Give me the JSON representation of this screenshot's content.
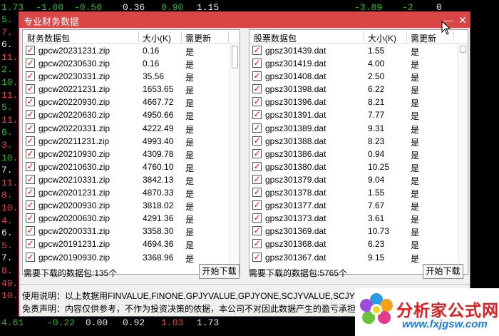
{
  "background": {
    "top_row": [
      "1.73",
      "-1.00",
      "-0.56",
      "0.36",
      "0.90",
      "1.15",
      "-3.89",
      "-2",
      "0"
    ],
    "bottom_row": [
      "4.61",
      "-0.22",
      "0.00",
      "0.92",
      "1.03",
      "1.73"
    ],
    "left_nums": [
      "5.",
      "7.",
      "6.",
      "11.",
      "2.",
      "10.",
      "11.",
      "5.",
      "11.",
      "6.",
      "3.",
      "10.",
      "7.",
      "11.",
      "8.",
      "10.",
      "4.",
      "6.",
      "5.",
      "7.",
      "8.",
      "49.",
      "10."
    ],
    "right_nums": [
      "",
      "",
      "",
      "",
      "",
      "",
      "",
      "",
      "",
      "",
      "",
      "",
      "",
      "",
      "",
      "",
      "",
      "",
      "",
      "",
      ""
    ]
  },
  "dialog": {
    "title": "专业财务数据",
    "minimize": "—",
    "close": "✕",
    "left": {
      "col_name": "财务数据包",
      "col_size": "大小(K)",
      "col_update": "需更新",
      "rows": [
        {
          "name": "gpcw20231231.zip",
          "size": "0.16",
          "update": "是"
        },
        {
          "name": "gpcw20230630.zip",
          "size": "0.16",
          "update": "是"
        },
        {
          "name": "gpcw20230331.zip",
          "size": "35.56",
          "update": "是"
        },
        {
          "name": "gpcw20221231.zip",
          "size": "1653.65",
          "update": "是"
        },
        {
          "name": "gpcw20220930.zip",
          "size": "4667.72",
          "update": "是"
        },
        {
          "name": "gpcw20220630.zip",
          "size": "4950.66",
          "update": "是"
        },
        {
          "name": "gpcw20220331.zip",
          "size": "4222.49",
          "update": "是"
        },
        {
          "name": "gpcw20211231.zip",
          "size": "4993.40",
          "update": "是"
        },
        {
          "name": "gpcw20210930.zip",
          "size": "4309.78",
          "update": "是"
        },
        {
          "name": "gpcw20210630.zip",
          "size": "4760.10",
          "update": "是"
        },
        {
          "name": "gpcw20210331.zip",
          "size": "3842.13",
          "update": "是"
        },
        {
          "name": "gpcw20201231.zip",
          "size": "4870.33",
          "update": "是"
        },
        {
          "name": "gpcw20200930.zip",
          "size": "3818.02",
          "update": "是"
        },
        {
          "name": "gpcw20200630.zip",
          "size": "4291.36",
          "update": "是"
        },
        {
          "name": "gpcw20200331.zip",
          "size": "3358.30",
          "update": "是"
        },
        {
          "name": "gpcw20191231.zip",
          "size": "4694.36",
          "update": "是"
        },
        {
          "name": "gpcw20190930.zip",
          "size": "3368.96",
          "update": "是"
        }
      ],
      "count_label": "需要下载的数据包:135个",
      "start_btn": "开始下载"
    },
    "right": {
      "col_name": "股票数据包",
      "col_size": "大小(K)",
      "col_update": "需更新",
      "rows": [
        {
          "name": "gpsz301439.dat",
          "size": "1.55",
          "update": "是"
        },
        {
          "name": "gpsz301419.dat",
          "size": "4.00",
          "update": "是"
        },
        {
          "name": "gpsz301408.dat",
          "size": "2.50",
          "update": "是"
        },
        {
          "name": "gpsz301398.dat",
          "size": "6.22",
          "update": "是"
        },
        {
          "name": "gpsz301396.dat",
          "size": "8.21",
          "update": "是"
        },
        {
          "name": "gpsz301391.dat",
          "size": "7.77",
          "update": "是"
        },
        {
          "name": "gpsz301389.dat",
          "size": "9.31",
          "update": "是"
        },
        {
          "name": "gpsz301388.dat",
          "size": "8.23",
          "update": "是"
        },
        {
          "name": "gpsz301386.dat",
          "size": "0.94",
          "update": "是"
        },
        {
          "name": "gpsz301380.dat",
          "size": "10.25",
          "update": "是"
        },
        {
          "name": "gpsz301379.dat",
          "size": "9.04",
          "update": "是"
        },
        {
          "name": "gpsz301378.dat",
          "size": "1.55",
          "update": "是"
        },
        {
          "name": "gpsz301377.dat",
          "size": "7.67",
          "update": "是"
        },
        {
          "name": "gpsz301373.dat",
          "size": "3.61",
          "update": "是"
        },
        {
          "name": "gpsz301369.dat",
          "size": "10.73",
          "update": "是"
        },
        {
          "name": "gpsz301368.dat",
          "size": "6.23",
          "update": "是"
        },
        {
          "name": "gpsz301367.dat",
          "size": "9.15",
          "update": "是"
        }
      ],
      "count_label": "需要下载的数据包:5765个",
      "start_btn": "开始下载"
    },
    "usage": "使用说明：以上数据用FINVALUE,FINONE,GPJYVALUE,GPJYONE,SCJYVALUE,SCJYONE等函数来调用",
    "disclaimer": "免责声明：内容仅供参考，不作为投资决策的依据，本公司不对因此数据产生的盈亏承担"
  },
  "watermark": {
    "cn": "分析家公式网",
    "url": "www.fxjgsw.com"
  }
}
